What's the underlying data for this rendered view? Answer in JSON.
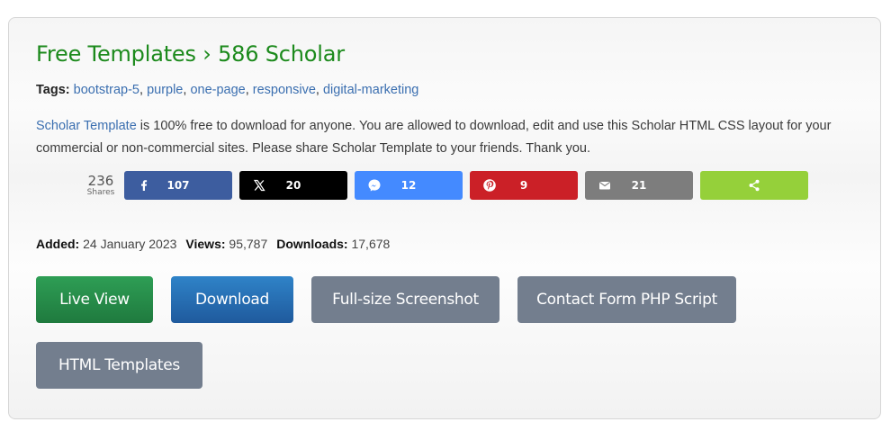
{
  "header": {
    "breadcrumb_root": "Free Templates",
    "breadcrumb_sep": "›",
    "breadcrumb_current": "586 Scholar"
  },
  "tags": {
    "label": "Tags:",
    "items": [
      "bootstrap-5",
      "purple",
      "one-page",
      "responsive",
      "digital-marketing"
    ]
  },
  "description": {
    "link_text": "Scholar Template",
    "text": " is 100% free to download for anyone. You are allowed to download, edit and use this Scholar HTML CSS layout for your commercial or non-commercial sites. Please share Scholar Template to your friends. Thank you."
  },
  "share": {
    "total": "236",
    "total_label": "Shares",
    "buttons": [
      {
        "network": "facebook",
        "icon": "facebook-icon",
        "count": "107",
        "color": "#3d5d9f"
      },
      {
        "network": "x",
        "icon": "x-icon",
        "count": "20",
        "color": "#000000"
      },
      {
        "network": "messenger",
        "icon": "messenger-icon",
        "count": "12",
        "color": "#448aff"
      },
      {
        "network": "pinterest",
        "icon": "pinterest-icon",
        "count": "9",
        "color": "#cb2027"
      },
      {
        "network": "email",
        "icon": "email-icon",
        "count": "21",
        "color": "#7d7d7d"
      },
      {
        "network": "share",
        "icon": "share-icon",
        "count": "",
        "color": "#95d03a"
      }
    ]
  },
  "meta": {
    "added_label": "Added:",
    "added_value": "24 January 2023",
    "views_label": "Views:",
    "views_value": "95,787",
    "downloads_label": "Downloads:",
    "downloads_value": "17,678"
  },
  "actions": {
    "live_view": "Live View",
    "download": "Download",
    "screenshot": "Full-size Screenshot",
    "contact_form": "Contact Form PHP Script",
    "html_templates": "HTML Templates"
  },
  "colors": {
    "title_green": "#1c8a1c",
    "link_blue": "#3b6fb0",
    "live_green": "#2a914c",
    "download_blue": "#2670b5",
    "gray_button": "#737e8e"
  }
}
